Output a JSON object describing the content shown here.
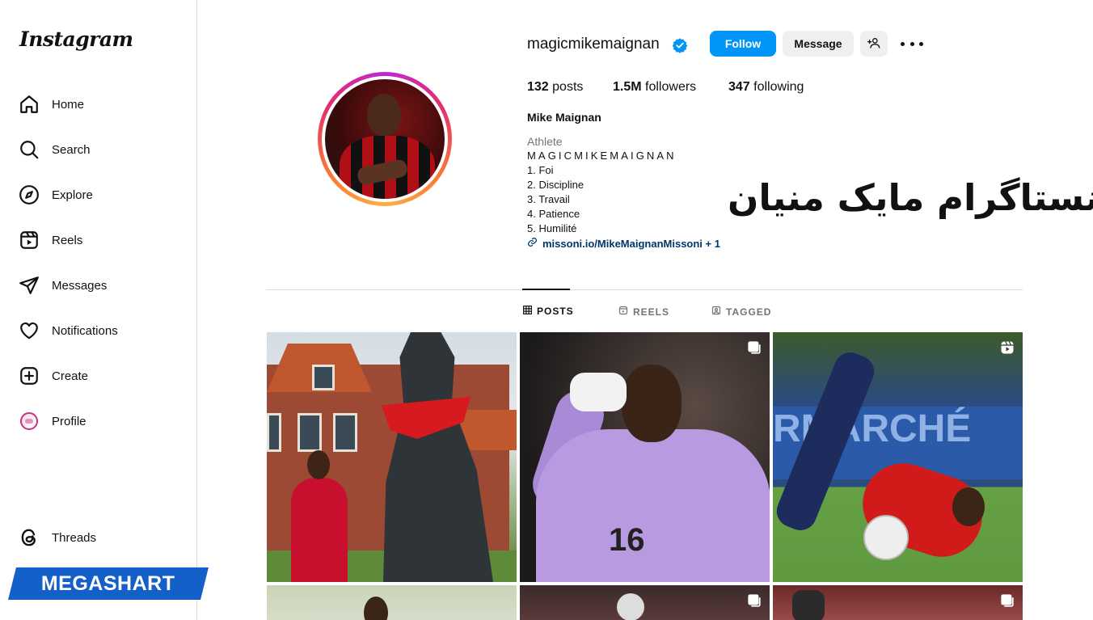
{
  "sidebar": {
    "logo": "Instagram",
    "items": [
      {
        "label": "Home",
        "icon": "home-icon"
      },
      {
        "label": "Search",
        "icon": "search-icon"
      },
      {
        "label": "Explore",
        "icon": "compass-icon"
      },
      {
        "label": "Reels",
        "icon": "reels-icon"
      },
      {
        "label": "Messages",
        "icon": "send-icon"
      },
      {
        "label": "Notifications",
        "icon": "heart-icon"
      },
      {
        "label": "Create",
        "icon": "plus-square-icon"
      },
      {
        "label": "Profile",
        "icon": "avatar-icon"
      }
    ],
    "threads_label": "Threads"
  },
  "watermark": {
    "text": "MEGASHART",
    "color": "#1560c8"
  },
  "profile": {
    "username": "magicmikemaignan",
    "verified": true,
    "follow_label": "Follow",
    "message_label": "Message",
    "stats": {
      "posts_count": "132",
      "posts_label": "posts",
      "followers_count": "1.5M",
      "followers_label": "followers",
      "following_count": "347",
      "following_label": "following"
    },
    "full_name": "Mike Maignan",
    "category": "Athlete",
    "bio": [
      "MAGICMIKEMAIGNAN",
      "1. Foi",
      "2. Discipline",
      "3. Travail",
      "4. Patience",
      "5. Humilité"
    ],
    "link": "missoni.io/MikeMaignanMissoni + 1"
  },
  "overlay_caption": "اینستاگرام مایک منیان",
  "tabs": [
    {
      "label": "POSTS",
      "active": true
    },
    {
      "label": "REELS",
      "active": false
    },
    {
      "label": "TAGGED",
      "active": false
    }
  ],
  "posts": [
    {
      "badge": "none"
    },
    {
      "badge": "carousel-icon"
    },
    {
      "badge": "reel-icon"
    },
    {
      "badge": "none"
    },
    {
      "badge": "carousel-icon"
    },
    {
      "badge": "carousel-icon"
    }
  ],
  "post_text": {
    "jersey_number": "16",
    "banner": "RMARCHÉ"
  },
  "colors": {
    "follow_button": "#0095f6",
    "link": "#00376b",
    "verified": "#0095f6"
  }
}
